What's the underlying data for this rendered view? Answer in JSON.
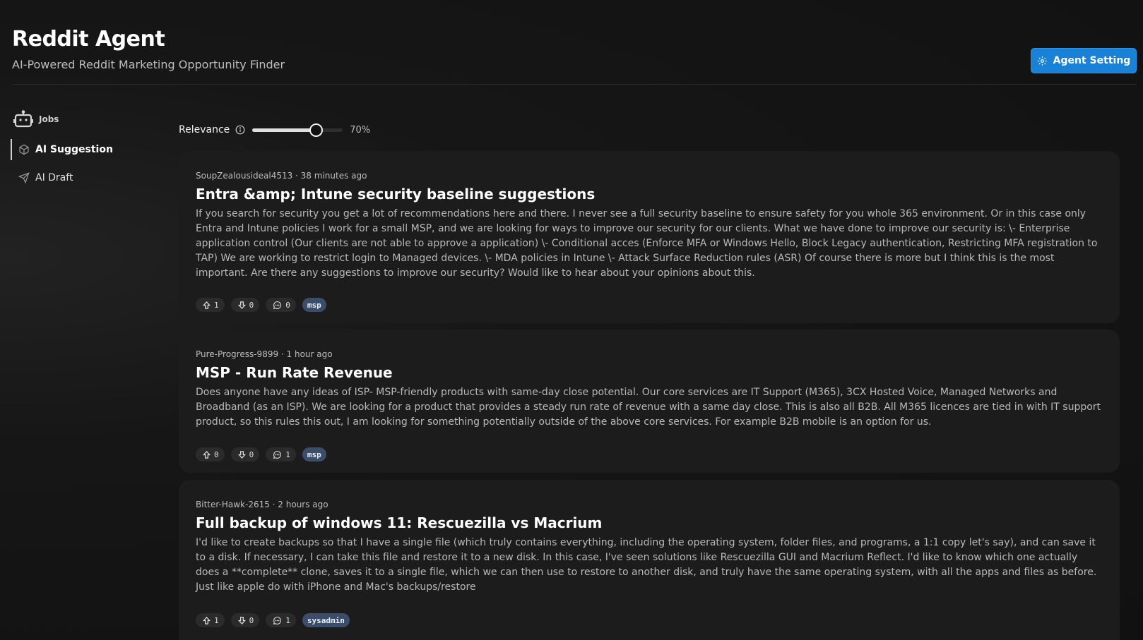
{
  "header": {
    "title": "Reddit Agent",
    "subtitle": "AI-Powered Reddit Marketing Opportunity Finder",
    "settings_button": "Agent Setting"
  },
  "sidebar": {
    "jobs_label": "Jobs",
    "items": [
      {
        "label": "AI Suggestion",
        "icon": "cube-icon",
        "active": true
      },
      {
        "label": "AI Draft",
        "icon": "paper-plane-icon",
        "active": false
      }
    ]
  },
  "filter": {
    "relevance_label": "Relevance",
    "relevance_value_text": "70%",
    "relevance_value": 0.7
  },
  "posts": [
    {
      "meta": "SoupZealousideal4513 · 38 minutes ago",
      "title": "Entra &amp; Intune security baseline suggestions",
      "body": "If you search for security you get a lot of recommendations here and there. I never see a full security baseline to ensure safety for you whole 365 environment. Or in this case only Entra and Intune policies I work for a small MSP, and we are looking for ways to improve our security for our clients. What we have done to improve our security is: \\- Enterprise application control (Our clients are not able to approve a application) \\- Conditional acces (Enforce MFA or Windows Hello, Block Legacy authentication, Restricting MFA registration to TAP) We are working to restrict login to Managed devices. \\- MDA policies in Intune \\- Attack Surface Reduction rules (ASR) Of course there is more but I think this is the most important. Are there any suggestions to improve our security? Would like to hear about your opinions about this.",
      "upvotes": "1",
      "downvotes": "0",
      "comments": "0",
      "tag": "msp"
    },
    {
      "meta": "Pure-Progress-9899 · 1 hour ago",
      "title": "MSP - Run Rate Revenue",
      "body": "Does anyone have any ideas of ISP- MSP-friendly products with same-day close potential. Our core services are IT Support (M365), 3CX Hosted Voice, Managed Networks and Broadband (as an ISP). We are looking for a product that provides a steady run rate of revenue with a same day close. This is also all B2B. All M365 licences are tied in with IT support product, so this rules this out, I am looking for something potentially outside of the above core services. For example B2B mobile is an option for us.",
      "upvotes": "0",
      "downvotes": "0",
      "comments": "1",
      "tag": "msp"
    },
    {
      "meta": "Bitter-Hawk-2615 · 2 hours ago",
      "title": "Full backup of windows 11: Rescuezilla vs Macrium",
      "body": "I'd like to create backups so that I have a single file (which truly contains everything, including the operating system, folder files, and programs, a 1:1 copy let's say), and can save it to a disk. If necessary, I can take this file and restore it to a new disk. In this case, I've seen solutions like Rescuezilla GUI and Macrium Reflect. I'd like to know which one actually does a **complete** clone, saves it to a single file, which we can then use to restore to another disk, and truly have the same operating system, with all the apps and files as before. Just like apple do with iPhone and Mac's backups/restore",
      "upvotes": "1",
      "downvotes": "0",
      "comments": "1",
      "tag": "sysadmin"
    }
  ],
  "colors": {
    "accent": "#1a82d6",
    "tag_bg": "#3b4d69",
    "card_bg": "#1c1c1c"
  }
}
